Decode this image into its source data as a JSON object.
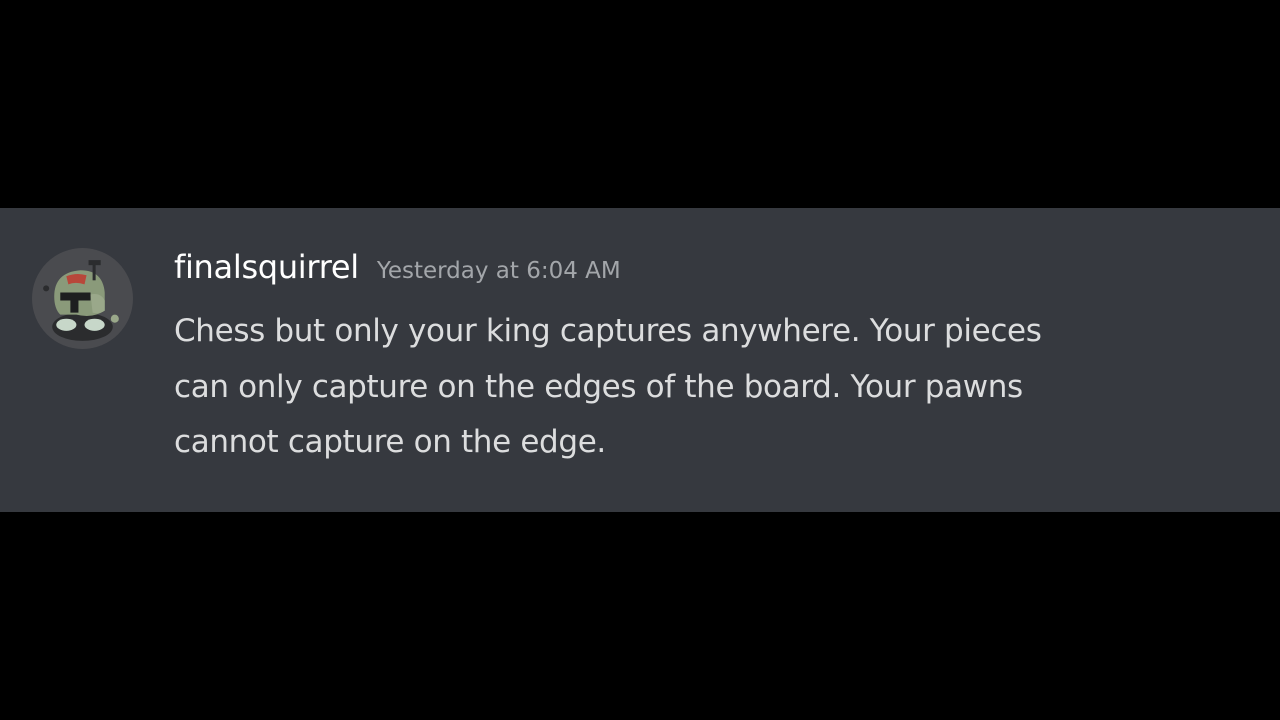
{
  "message": {
    "author": {
      "username": "finalsquirrel",
      "avatar_icon": "helmet-avatar-icon"
    },
    "timestamp": "Yesterday at 6:04 AM",
    "content_lines": [
      "Chess but only your king captures anywhere. Your pieces",
      "can only capture on the edges of the board. Your pawns",
      "cannot capture on the edge."
    ]
  },
  "colors": {
    "background": "#000000",
    "message_background": "#36393f",
    "username": "#ffffff",
    "timestamp": "#a3a6aa",
    "text": "#dcddde"
  }
}
